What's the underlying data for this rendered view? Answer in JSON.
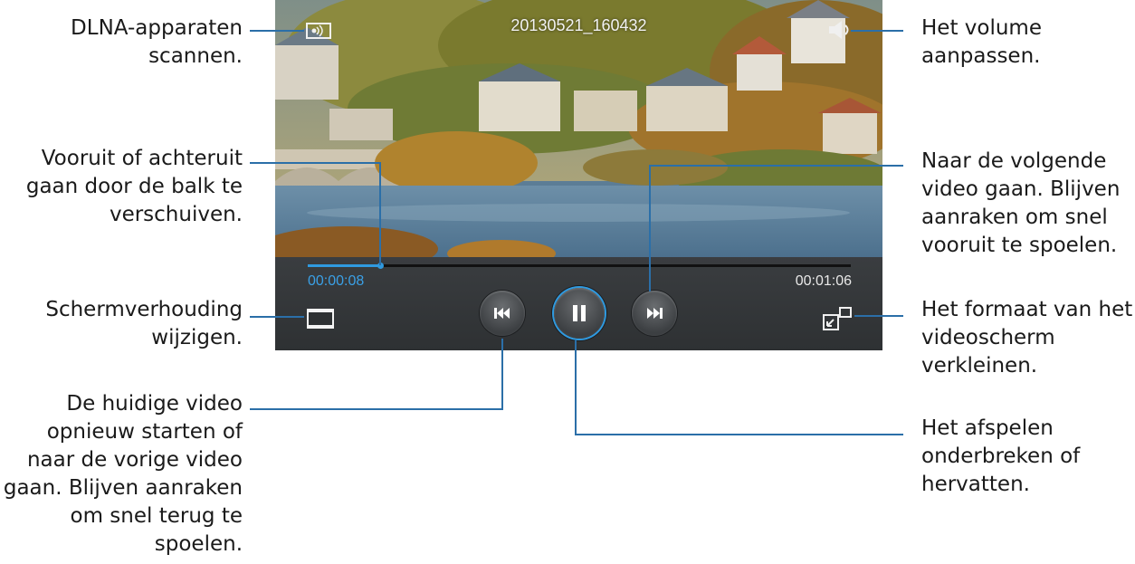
{
  "video": {
    "title": "20130521_160432",
    "elapsed": "00:00:08",
    "total": "00:01:06",
    "progress_fraction": 0.133
  },
  "icons": {
    "dlna": "dlna-icon",
    "volume": "volume-icon",
    "aspect": "aspect-ratio-icon",
    "prev": "previous-icon",
    "pause": "pause-icon",
    "next": "next-icon",
    "popup": "popup-player-icon"
  },
  "colors": {
    "accent": "#2f9ae0",
    "leader": "#2b6fa8"
  },
  "callouts": {
    "dlna": "DLNA-apparaten\nscannen.",
    "seek": "Vooruit of achteruit\ngaan door de balk te\nverschuiven.",
    "aspect": "Schermverhouding\nwijzigen.",
    "prev": "De huidige video\nopnieuw starten of\nnaar de vorige video\ngaan. Blijven aanraken\nom snel terug te\nspoelen.",
    "volume": "Het volume\naanpassen.",
    "next": "Naar de volgende\nvideo gaan. Blijven\naanraken om snel\nvooruit te spoelen.",
    "popup": "Het formaat van het\nvideoscherm\nverkleinen.",
    "pause": "Het afspelen\nonderbreken of\nhervatten."
  }
}
